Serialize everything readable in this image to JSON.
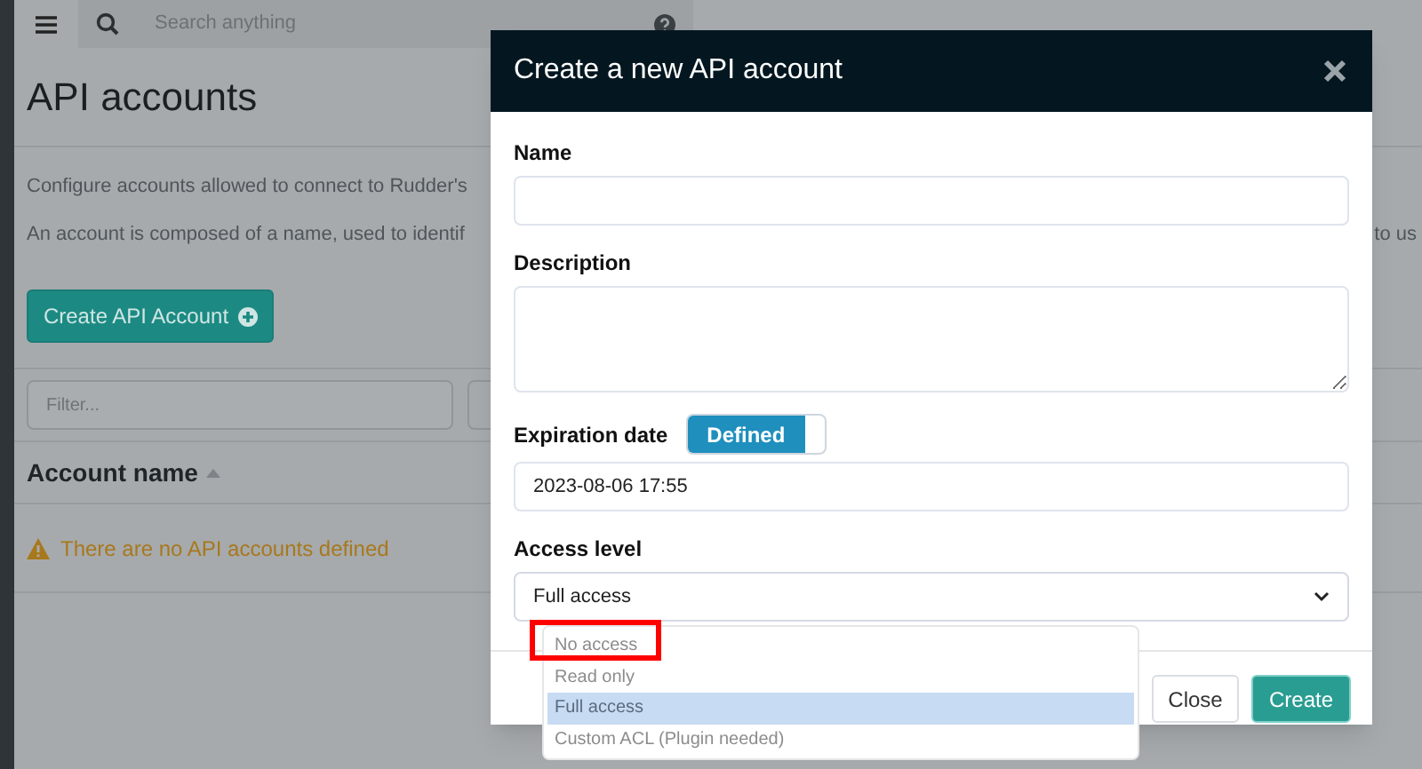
{
  "topbar": {
    "search_placeholder": "Search anything"
  },
  "page": {
    "title": "API accounts",
    "intro": [
      {
        "text": "Configure accounts allowed to connect to Rudder's"
      },
      {
        "text": "An account is composed of a name, used to identif",
        "tail": "to us"
      }
    ],
    "create_button": "Create API Account",
    "filter_placeholder": "Filter...",
    "columns": [
      {
        "label": "Account name",
        "sorted": true
      }
    ],
    "empty_message": "There are no API accounts defined"
  },
  "dialog": {
    "title": "Create a new API account",
    "fields": [
      {
        "kind": "text",
        "label": "Name"
      },
      {
        "kind": "textarea",
        "label": "Description"
      },
      {
        "kind": "date",
        "label": "Expiration date",
        "toggle": {
          "label": "Defined",
          "on": true
        },
        "value": "2023-08-06 17:55"
      },
      {
        "kind": "select",
        "label": "Access level",
        "value": "Full access",
        "expanded": true,
        "options": [
          {
            "label": "No access",
            "selected": false,
            "annotated": true
          },
          {
            "label": "Read only",
            "selected": false,
            "annotated": false
          },
          {
            "label": "Full access",
            "selected": true,
            "annotated": false
          },
          {
            "label": "Custom ACL (Plugin needed)",
            "selected": false,
            "annotated": false
          }
        ]
      }
    ],
    "buttons": [
      {
        "label": "Close",
        "kind": "secondary"
      },
      {
        "label": "Create",
        "kind": "primary"
      }
    ]
  }
}
